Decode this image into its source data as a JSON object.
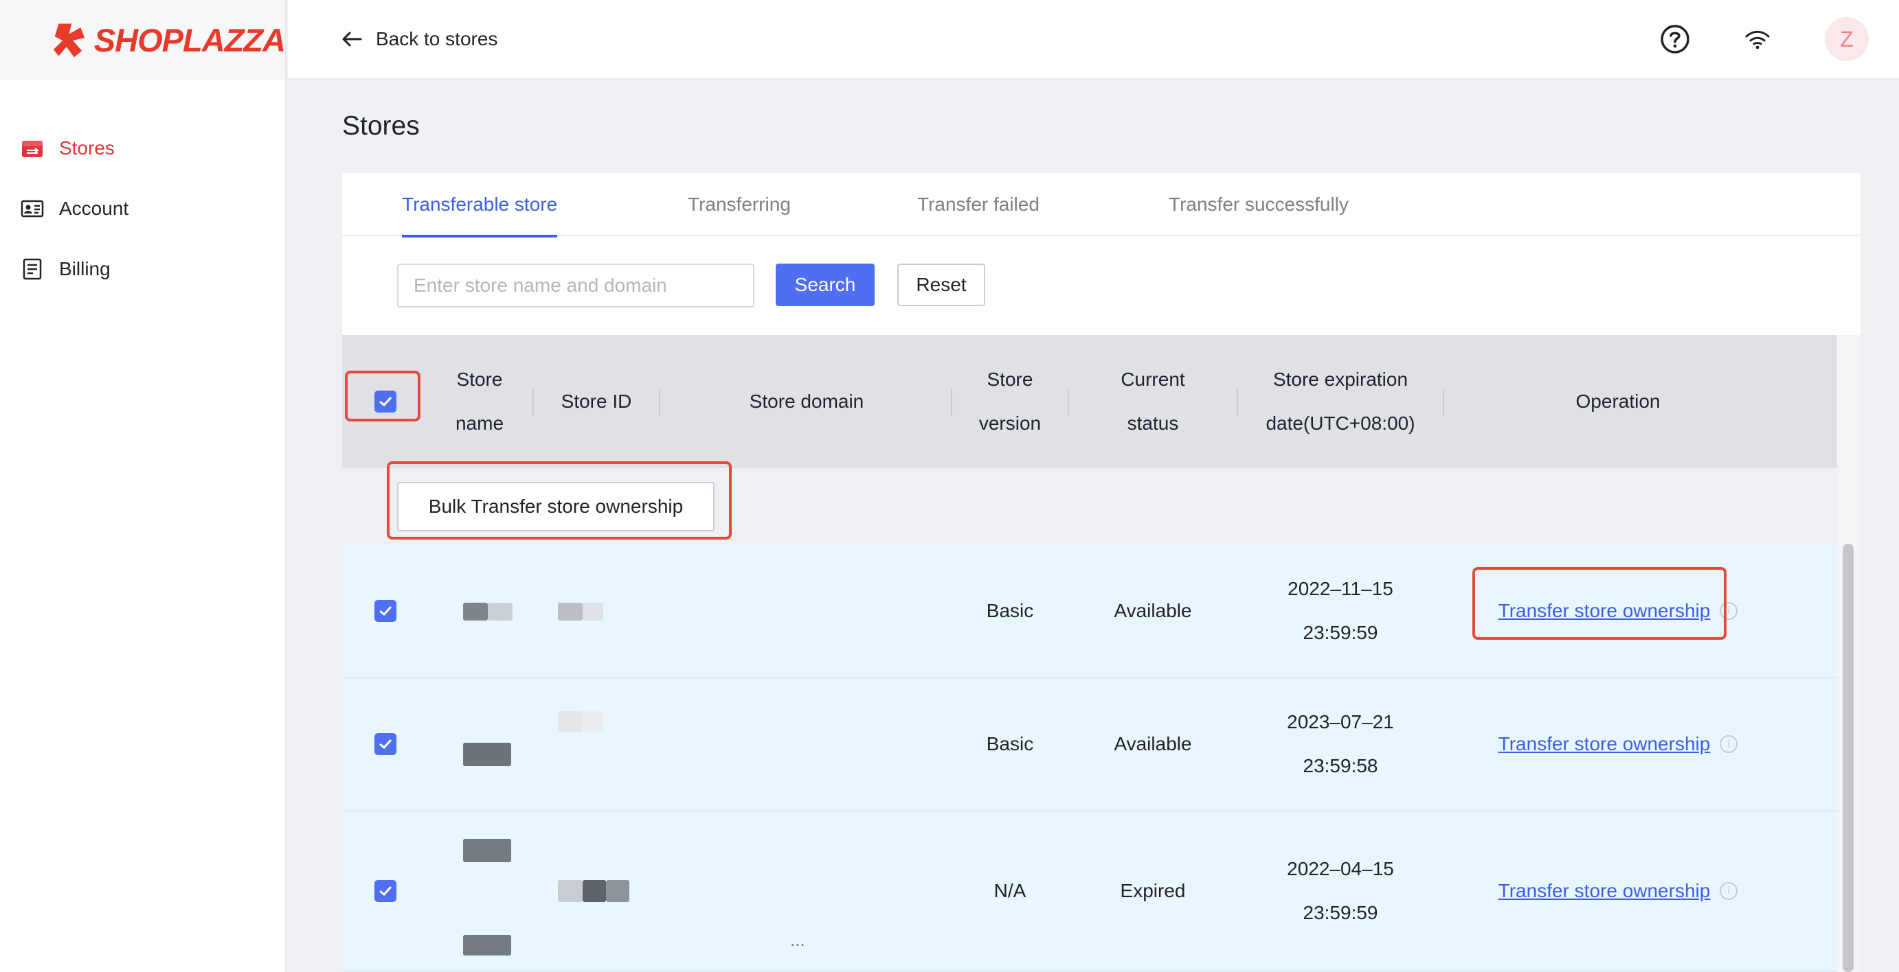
{
  "brand": {
    "name": "SHOPLAZZA",
    "accent": "#e63a2a"
  },
  "sidebar": {
    "items": [
      {
        "label": "Stores",
        "icon": "store-icon",
        "active": true
      },
      {
        "label": "Account",
        "icon": "id-card-icon",
        "active": false
      },
      {
        "label": "Billing",
        "icon": "document-icon",
        "active": false
      }
    ]
  },
  "header": {
    "back_label": "Back to stores",
    "icons": [
      "help-icon",
      "wifi-icon"
    ],
    "avatar_initial": "Z"
  },
  "page": {
    "title": "Stores"
  },
  "tabs": [
    {
      "label": "Transferable store",
      "active": true
    },
    {
      "label": "Transferring",
      "active": false
    },
    {
      "label": "Transfer failed",
      "active": false
    },
    {
      "label": "Transfer successfully",
      "active": false
    }
  ],
  "filter": {
    "placeholder": "Enter store name and domain",
    "search_label": "Search",
    "reset_label": "Reset"
  },
  "table": {
    "columns": [
      "Store name",
      "Store ID",
      "Store domain",
      "Store version",
      "Current status",
      "Store expiration date(UTC+08:00)",
      "Operation"
    ],
    "column_lines": {
      "name": [
        "Store",
        "name"
      ],
      "version": [
        "Store",
        "version"
      ],
      "status": [
        "Current",
        "status"
      ],
      "expiry": [
        "Store expiration",
        "date(UTC+08:00)"
      ]
    },
    "bulk_label": "Bulk Transfer store ownership",
    "rows": [
      {
        "checked": true,
        "version": "Basic",
        "status": "Available",
        "date": "2022–11–15",
        "time": "23:59:59",
        "operation": "Transfer store ownership"
      },
      {
        "checked": true,
        "version": "Basic",
        "status": "Available",
        "date": "2023–07–21",
        "time": "23:59:58",
        "operation": "Transfer store ownership"
      },
      {
        "checked": true,
        "version": "N/A",
        "status": "Expired",
        "date": "2022–04–15",
        "time": "23:59:59",
        "operation": "Transfer store ownership"
      }
    ],
    "domain_truncation": "..."
  },
  "colors": {
    "primary": "#4f6ef0",
    "link": "#3b5fe0",
    "active_nav": "#d9373d",
    "row_highlight": "#eaf6fd",
    "annotation": "#e34b38"
  }
}
